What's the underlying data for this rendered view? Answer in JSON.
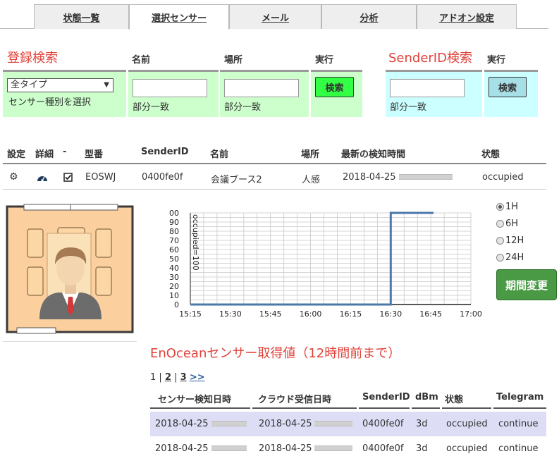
{
  "tabs": [
    {
      "label": "状態一覧"
    },
    {
      "label": "選択センサー"
    },
    {
      "label": "メール"
    },
    {
      "label": "分析"
    },
    {
      "label": "アドオン設定"
    }
  ],
  "registry_search": {
    "title": "登録検索",
    "col_name": "名前",
    "col_place": "場所",
    "col_exec": "実行",
    "type_select_value": "全タイプ",
    "type_hint": "センサー種別を選択",
    "name_hint": "部分一致",
    "place_hint": "部分一致",
    "search_button": "検索"
  },
  "senderid_search": {
    "title": "SenderID検索",
    "col_exec": "実行",
    "hint": "部分一致",
    "search_button": "検索"
  },
  "sensor_table": {
    "headers": [
      "設定",
      "詳細",
      "-",
      "型番",
      "SenderID",
      "名前",
      "場所",
      "最新の検知時間",
      "状態"
    ],
    "row": {
      "model": "EOSWJ",
      "sender_id": "0400fe0f",
      "name": "会議ブース2",
      "place": "人感",
      "last_detected": "2018-04-25",
      "status": "occupied"
    }
  },
  "chart_data": {
    "type": "line",
    "title": "",
    "xlabel": "",
    "ylabel": "",
    "series_label_text": "occupied=100",
    "x_ticks": [
      "15:15",
      "15:30",
      "15:45",
      "16:00",
      "16:15",
      "16:30",
      "16:45",
      "17:00"
    ],
    "y_ticks": [
      0,
      10,
      20,
      30,
      40,
      50,
      60,
      70,
      80,
      90,
      100
    ],
    "ylim": [
      0,
      100
    ],
    "series": [
      {
        "x": [
          "15:15",
          "16:30",
          "16:30",
          "16:46"
        ],
        "y": [
          0,
          0,
          100,
          100
        ],
        "color": "#4a78a8"
      }
    ],
    "grid": true
  },
  "period": {
    "options": [
      "1H",
      "6H",
      "12H",
      "24H"
    ],
    "selected": "1H",
    "button": "期間変更"
  },
  "enocean": {
    "title": "EnOceanセンサー取得値（12時間前まで）",
    "pager": {
      "current": "1",
      "sep1": " | ",
      "p2": "2",
      "sep2": " | ",
      "p3": "3",
      "next": ">>"
    },
    "headers": [
      "センサー検知日時",
      "クラウド受信日時",
      "SenderID",
      "dBm",
      "状態",
      "Telegram"
    ],
    "rows": [
      {
        "detected": "2018-04-25",
        "received": "2018-04-25",
        "sender_id": "0400fe0f",
        "dbm": "3d",
        "status": "occupied",
        "telegram": "continue"
      },
      {
        "detected": "2018-04-25",
        "received": "2018-04-25",
        "sender_id": "0400fe0f",
        "dbm": "3d",
        "status": "occupied",
        "telegram": "continue"
      }
    ]
  },
  "colors": {
    "accent_red": "#e0423a",
    "panel_green": "#ccffcc",
    "panel_cyan": "#ccffff",
    "button_green": "#4a9a45",
    "row_alt": "#ddddf6"
  }
}
